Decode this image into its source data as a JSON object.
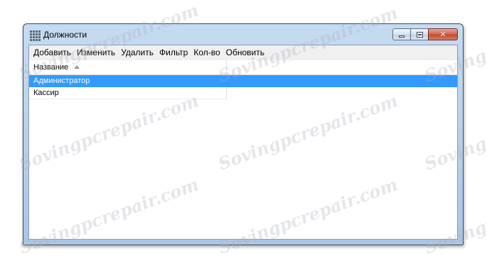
{
  "window": {
    "title": "Должности",
    "icon": "grid-icon",
    "controls": {
      "minimize": "minimize-icon",
      "maximize": "maximize-icon",
      "close": "close-icon",
      "close_glyph": "✕"
    }
  },
  "menu": {
    "items": [
      "Добавить",
      "Изменить",
      "Удалить",
      "Фильтр",
      "Кол-во",
      "Обновить"
    ]
  },
  "grid": {
    "columns": [
      {
        "label": "Название",
        "sort": "ascending"
      }
    ],
    "rows": [
      {
        "name": "Администратор",
        "selected": true
      },
      {
        "name": "Кассир",
        "selected": false
      }
    ]
  },
  "watermark": {
    "text": "Sovingpcrepair.com"
  },
  "colors": {
    "selection": "#3399ff",
    "close_button": "#c44a31",
    "frame": "#aac6e4"
  }
}
